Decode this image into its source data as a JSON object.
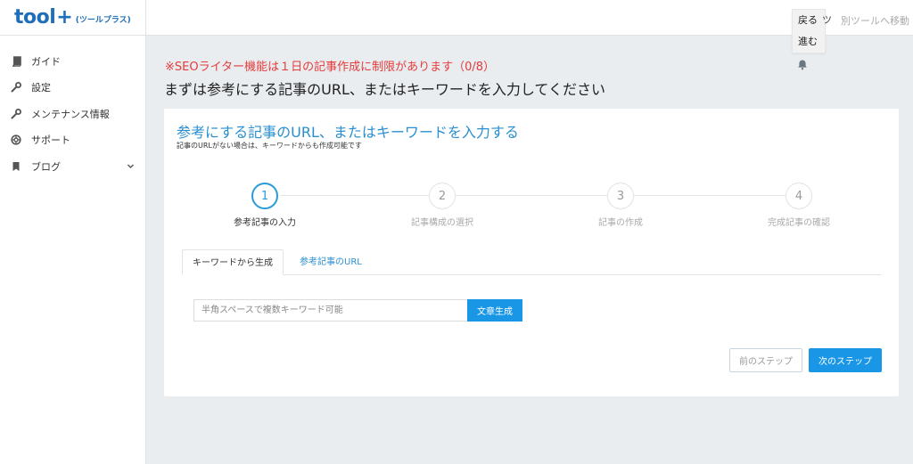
{
  "brand": {
    "logo_main": "tool",
    "logo_plus": "+",
    "logo_sub": "(ツールプラス)",
    "color": "#1f6fb8"
  },
  "sidebar": {
    "items": [
      {
        "label": "ガイド",
        "icon": "book-icon"
      },
      {
        "label": "設定",
        "icon": "wrench-icon"
      },
      {
        "label": "メンテナンス情報",
        "icon": "wrench-icon"
      },
      {
        "label": "サポート",
        "icon": "lifebuoy-icon"
      },
      {
        "label": "ブログ",
        "icon": "bookmark-icon",
        "has_submenu": true
      }
    ]
  },
  "topbar": {
    "other_tools_link": "別ツールへ移動"
  },
  "nav_popup": {
    "back": "戻る",
    "forward": "進む",
    "extra": "ツ"
  },
  "notice": "※SEOライター機能は１日の記事作成に制限があります（0/8）",
  "page_title": "まずは参考にする記事のURL、またはキーワードを入力してください",
  "card": {
    "title": "参考にする記事のURL、またはキーワードを入力する",
    "subtitle": "記事のURLがない場合は、キーワードからも作成可能です"
  },
  "steps": [
    {
      "number": "1",
      "label": "参考記事の入力",
      "active": true
    },
    {
      "number": "2",
      "label": "記事構成の選択",
      "active": false
    },
    {
      "number": "3",
      "label": "記事の作成",
      "active": false
    },
    {
      "number": "4",
      "label": "完成記事の確認",
      "active": false
    }
  ],
  "tabs": [
    {
      "label": "キーワードから生成",
      "active": true
    },
    {
      "label": "参考記事のURL",
      "active": false
    }
  ],
  "keyword_input": {
    "placeholder": "半角スペースで複数キーワード可能",
    "value": ""
  },
  "buttons": {
    "generate": "文章生成",
    "prev": "前のステップ",
    "next": "次のステップ"
  },
  "colors": {
    "accent": "#1a96e6",
    "link": "#2a8fd0",
    "warning": "#e53b3b",
    "background": "#e9edf0"
  }
}
